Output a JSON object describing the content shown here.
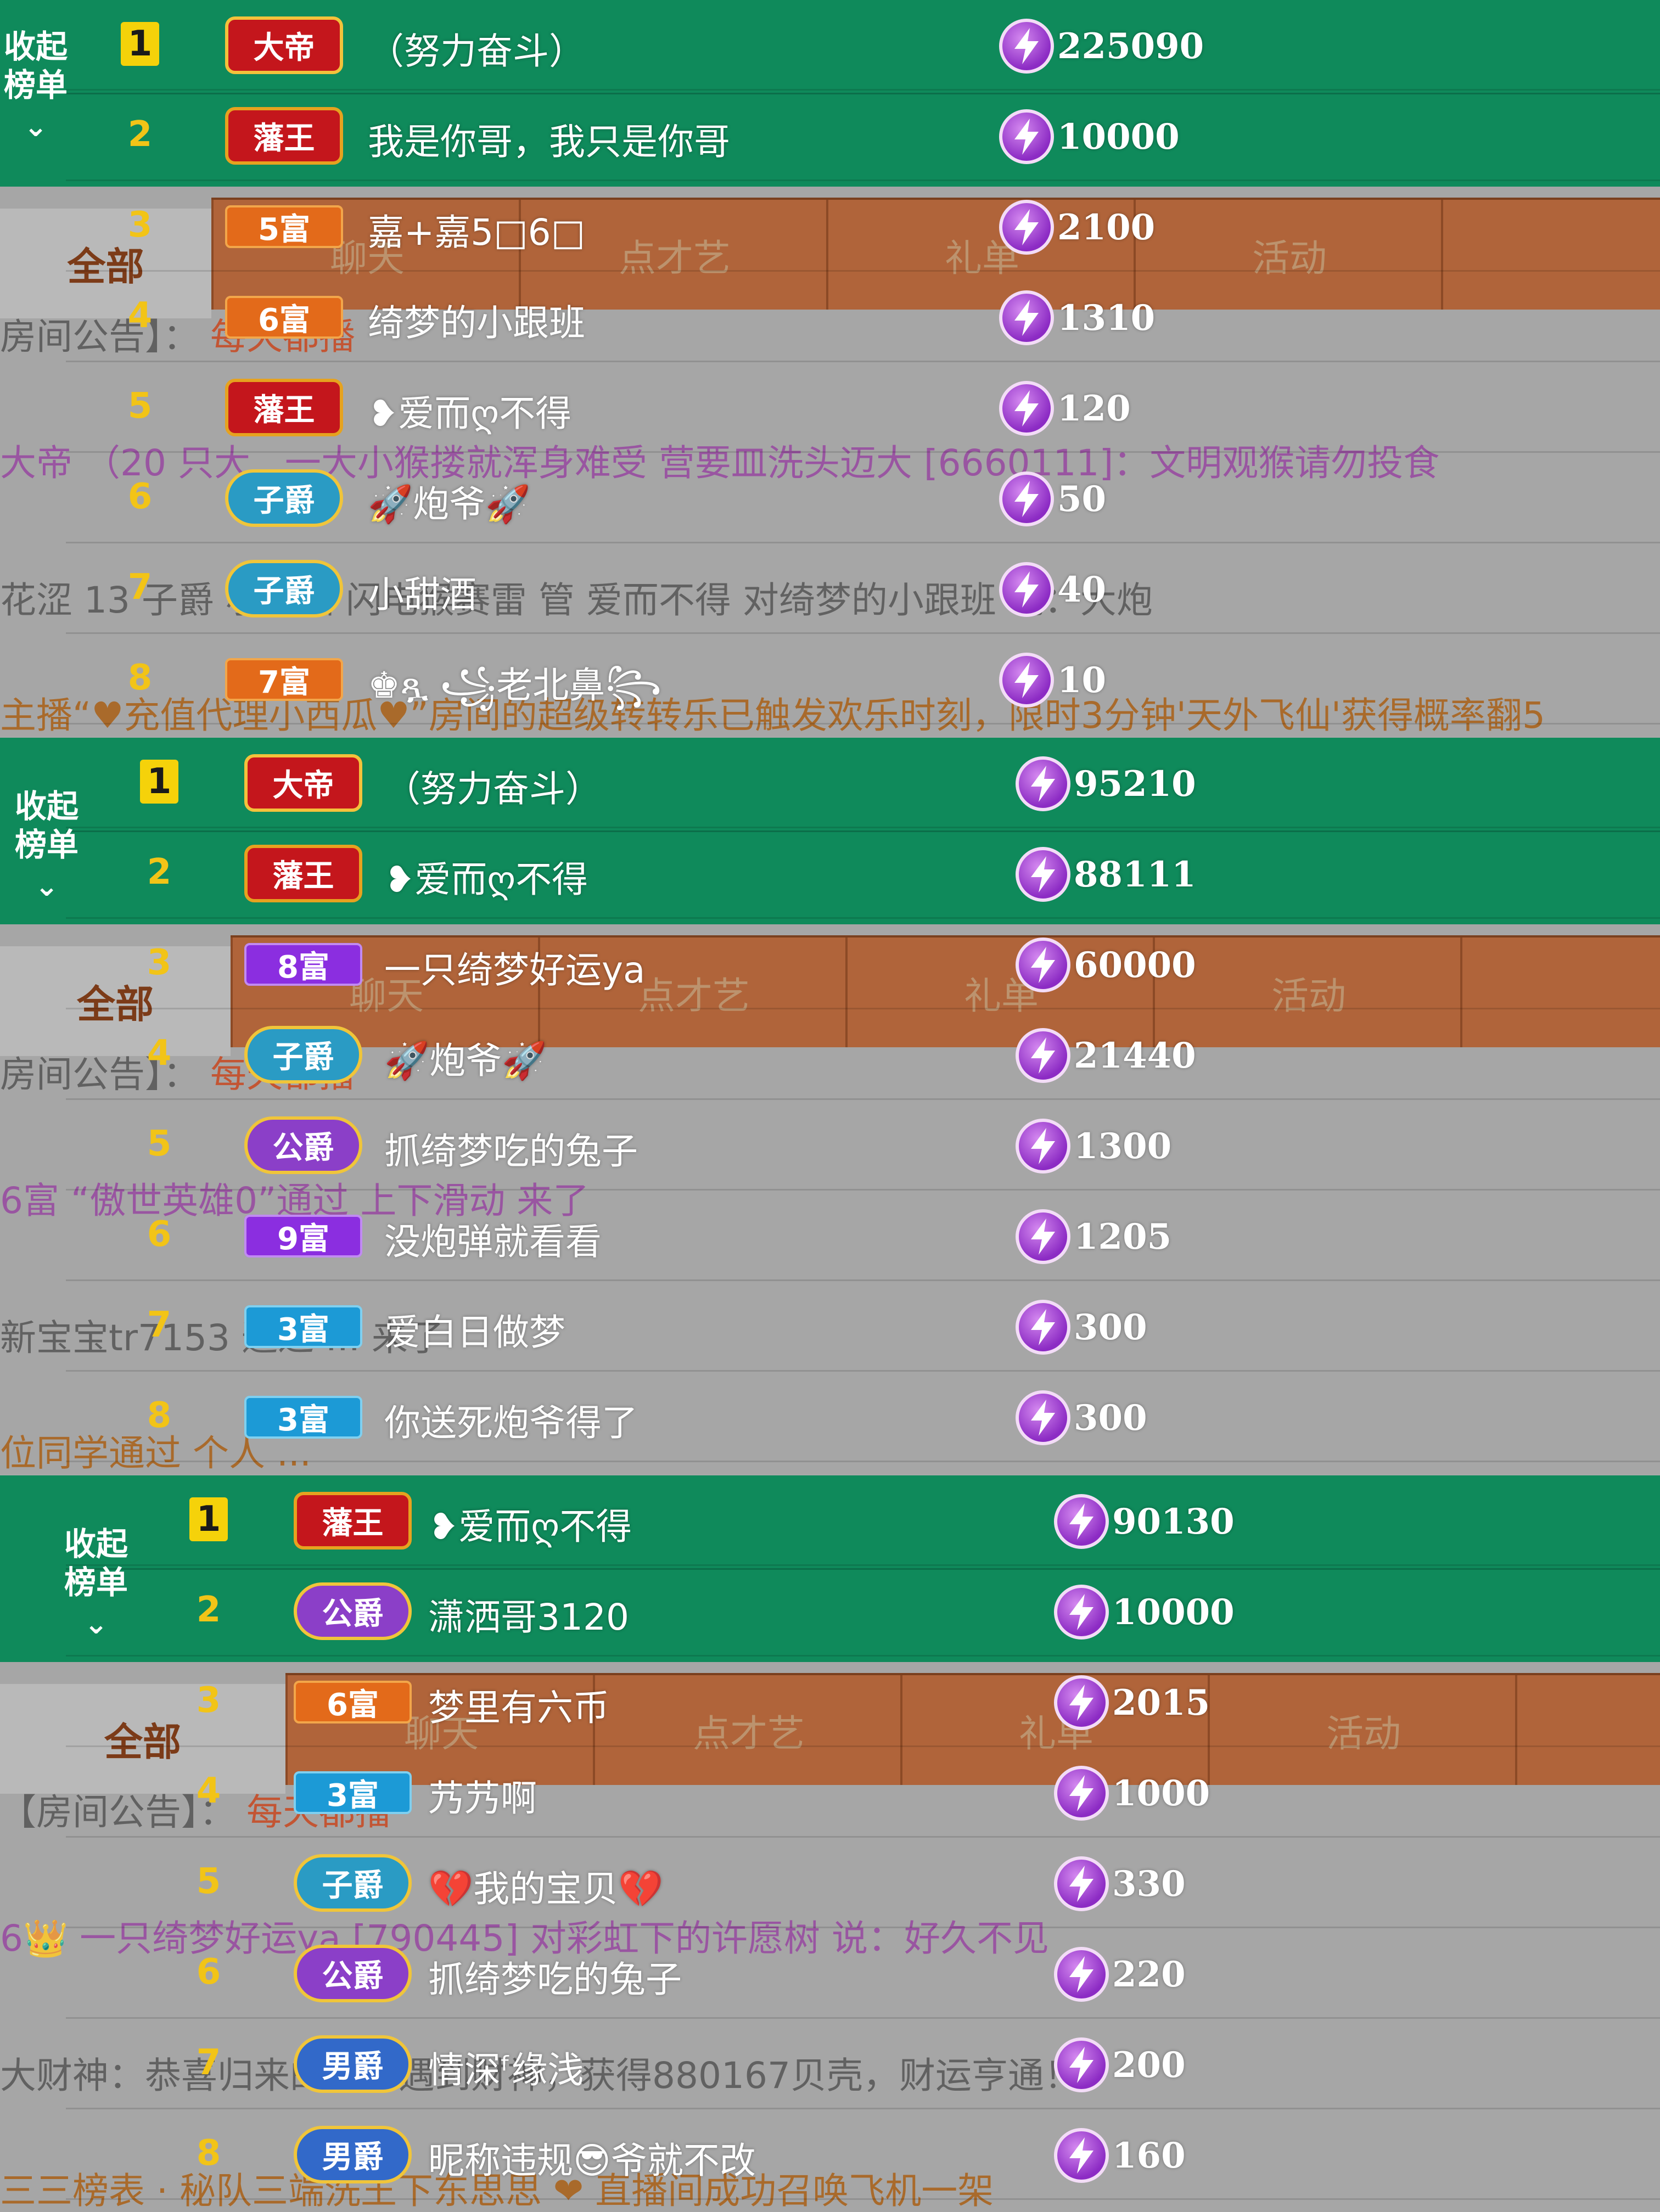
{
  "colors": {
    "green": "#0f8a5b",
    "tab": "#b0643a",
    "gold": "#f2c417",
    "bolt": "#8c2bc4"
  },
  "panels": [
    {
      "collapse": {
        "line1": "收起",
        "line2": "榜单",
        "chevron": "⌄"
      },
      "all_tab": "全部",
      "tabs": [
        {
          "label": "聊天"
        },
        {
          "label": "点才艺"
        },
        {
          "label": "礼单"
        },
        {
          "label": "活动"
        }
      ],
      "tab_count": "8",
      "bg_lines": [
        {
          "text": "房间公告】：",
          "accent": "每天都播"
        },
        {
          "text": "大帝 （20 只大..  一大小猴搂就浑身难受   营要皿洗头迈大 [6660111]：文明观猴请勿投食"
        },
        {
          "text": "花涩 13 子爵 小甜酒  闪电猴赛雷   管 爱而不得 对绮梦的小跟班 说：大炮"
        },
        {
          "text": "主播“♥充值代理小西瓜♥”房间的超级转转乐已触发欢乐时刻，限时3分钟'天外飞仙'获得概率翻5"
        }
      ],
      "rows": [
        {
          "rank": "1",
          "badge": "大帝",
          "badge_type": "crown",
          "name": "（努力奋斗）",
          "score": "225090"
        },
        {
          "rank": "2",
          "badge": "藩王",
          "badge_type": "prince",
          "name": "我是你哥，我只是你哥",
          "score": "10000"
        },
        {
          "rank": "3",
          "badge": "5富",
          "badge_type": "rich r5",
          "name": "嘉+嘉5□6□",
          "score": "2100"
        },
        {
          "rank": "4",
          "badge": "6富",
          "badge_type": "rich r6",
          "name": "绮梦的小跟班",
          "score": "1310"
        },
        {
          "rank": "5",
          "badge": "藩王",
          "badge_type": "prince",
          "name": "❥爱而ღ不得",
          "score": "120"
        },
        {
          "rank": "6",
          "badge": "子爵",
          "badge_type": "noble b-zijue",
          "name": "🚀炮爷🚀",
          "score": "50"
        },
        {
          "rank": "7",
          "badge": "子爵",
          "badge_type": "noble b-zijue",
          "name": "小甜酒",
          "score": "40"
        },
        {
          "rank": "8",
          "badge": "7富",
          "badge_type": "rich r7",
          "name": "♚ጿ ꧁老北鼻꧂",
          "score": "10"
        }
      ]
    },
    {
      "collapse": {
        "line1": "收起",
        "line2": "榜单",
        "chevron": "⌄"
      },
      "all_tab": "全部",
      "tabs": [
        {
          "label": "聊天"
        },
        {
          "label": "点才艺"
        },
        {
          "label": "礼单"
        },
        {
          "label": "活动"
        }
      ],
      "tab_count": "1",
      "bg_lines": [
        {
          "text": "房间公告】：",
          "accent": "每天都播"
        },
        {
          "text": "6富 “傲世英雄0”通过 上下滑动 来了"
        },
        {
          "text": "新宝宝tr7153 通过 ... 来了"
        },
        {
          "text": "位同学通过 个人 ..."
        }
      ],
      "rows": [
        {
          "rank": "1",
          "badge": "大帝",
          "badge_type": "crown",
          "name": "（努力奋斗）",
          "score": "95210"
        },
        {
          "rank": "2",
          "badge": "藩王",
          "badge_type": "prince",
          "name": "❥爱而ღ不得",
          "score": "88111"
        },
        {
          "rank": "3",
          "badge": "8富",
          "badge_type": "rich r8",
          "name": "一只绮梦好运ya",
          "score": "60000"
        },
        {
          "rank": "4",
          "badge": "子爵",
          "badge_type": "noble b-zijue",
          "name": "🚀炮爷🚀",
          "score": "21440"
        },
        {
          "rank": "5",
          "badge": "公爵",
          "badge_type": "noble b-gongjue",
          "name": "抓绮梦吃的兔子",
          "score": "1300"
        },
        {
          "rank": "6",
          "badge": "9富",
          "badge_type": "rich r9",
          "name": "没炮弹就看看",
          "score": "1205"
        },
        {
          "rank": "7",
          "badge": "3富",
          "badge_type": "rich r3",
          "name": "爱白日做梦",
          "score": "300"
        },
        {
          "rank": "8",
          "badge": "3富",
          "badge_type": "rich r3",
          "name": "你送死炮爷得了",
          "score": "300"
        }
      ]
    },
    {
      "collapse": {
        "line1": "收起",
        "line2": "榜单",
        "chevron": "⌄"
      },
      "all_tab": "全部",
      "tabs": [
        {
          "label": "聊天"
        },
        {
          "label": "点才艺"
        },
        {
          "label": "礼单"
        },
        {
          "label": "活动"
        }
      ],
      "tab_count": "",
      "bg_lines": [
        {
          "text": "【房间公告】：",
          "accent": "每天都播"
        },
        {
          "text": "6👑  一只绮梦好运ya [790445] 对彩虹下的许愿树 说：好久不见"
        },
        {
          "text": "大财神：恭喜归来的过客遇到财神，获得880167贝壳，财运亨通！"
        },
        {
          "text": "三三榜表 · 秘队三端洗王下东思思 ❤ 直播间成功召唤飞机一架"
        }
      ],
      "rows": [
        {
          "rank": "1",
          "badge": "藩王",
          "badge_type": "prince",
          "name": "❥爱而ღ不得",
          "score": "90130"
        },
        {
          "rank": "2",
          "badge": "公爵",
          "badge_type": "noble b-gongjue",
          "name": "潇洒哥3120",
          "score": "10000"
        },
        {
          "rank": "3",
          "badge": "6富",
          "badge_type": "rich r6",
          "name": "梦里有六币",
          "score": "2015"
        },
        {
          "rank": "4",
          "badge": "3富",
          "badge_type": "rich r3",
          "name": "艿艿啊",
          "score": "1000"
        },
        {
          "rank": "5",
          "badge": "子爵",
          "badge_type": "noble b-zijue",
          "name": "💔我的宝贝💔",
          "score": "330"
        },
        {
          "rank": "6",
          "badge": "公爵",
          "badge_type": "noble b-gongjue",
          "name": "抓绮梦吃的兔子",
          "score": "220"
        },
        {
          "rank": "7",
          "badge": "男爵",
          "badge_type": "noble b-nanjue",
          "name": "情深ᶠ缘浅",
          "score": "200"
        },
        {
          "rank": "8",
          "badge": "男爵",
          "badge_type": "noble b-nanjue",
          "name": "昵称违规😎爷就不改",
          "score": "160"
        }
      ]
    }
  ]
}
